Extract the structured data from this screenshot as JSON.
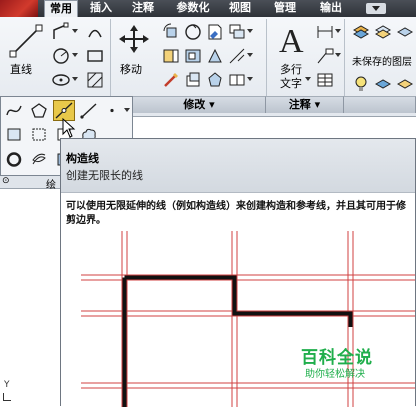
{
  "tabs": [
    "常用",
    "插入",
    "注释",
    "参数化",
    "视图",
    "管理",
    "输出"
  ],
  "ribbon": {
    "line_label": "直线",
    "move_label": "移动",
    "mtext_label": "多行",
    "mtext_label2": "文字",
    "modify_panel": "修改",
    "annotate_panel": "注释",
    "layer_state": "未保存的图层"
  },
  "left": {
    "drawing_label": "绘",
    "y_axis": "Y"
  },
  "tooltip": {
    "title": "构造线",
    "subtitle": "创建无限长的线",
    "description": "可以使用无限延伸的线（例如构造线）来创建构造和参考线，并且其可用于修剪边界。"
  },
  "watermark": {
    "main": "百科全说",
    "sub": "助你轻松解决"
  },
  "colors": {
    "ribbon_bg": "#e3e8ee",
    "tab_active": "#eef1f5",
    "highlight": "#e8c84a",
    "construction_line": "#d04040",
    "watermark": "#1fae4b"
  }
}
